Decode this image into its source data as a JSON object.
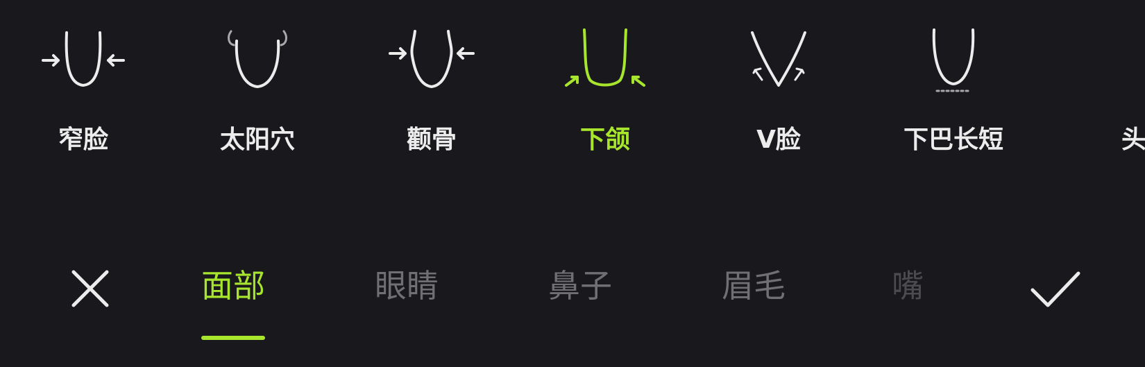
{
  "colors": {
    "background": "#19181c",
    "accent": "#a8e62e",
    "text": "#ececec",
    "tab_inactive": "#6f6f74"
  },
  "options": [
    {
      "label": "窄脸",
      "icon": "narrow-face-icon",
      "active": false
    },
    {
      "label": "太阳穴",
      "icon": "temple-icon",
      "active": false
    },
    {
      "label": "颧骨",
      "icon": "cheekbone-icon",
      "active": false
    },
    {
      "label": "下颌",
      "icon": "jaw-icon",
      "active": true
    },
    {
      "label": "V脸",
      "icon": "v-face-icon",
      "active": false
    },
    {
      "label": "下巴长短",
      "icon": "chin-length-icon",
      "active": false
    },
    {
      "label": "头",
      "icon": "",
      "active": false
    }
  ],
  "tabs": [
    {
      "label": "面部",
      "active": true
    },
    {
      "label": "眼睛",
      "active": false
    },
    {
      "label": "鼻子",
      "active": false
    },
    {
      "label": "眉毛",
      "active": false
    },
    {
      "label": "嘴",
      "active": false
    }
  ],
  "controls": {
    "cancel_icon": "close-icon",
    "confirm_icon": "check-icon"
  }
}
